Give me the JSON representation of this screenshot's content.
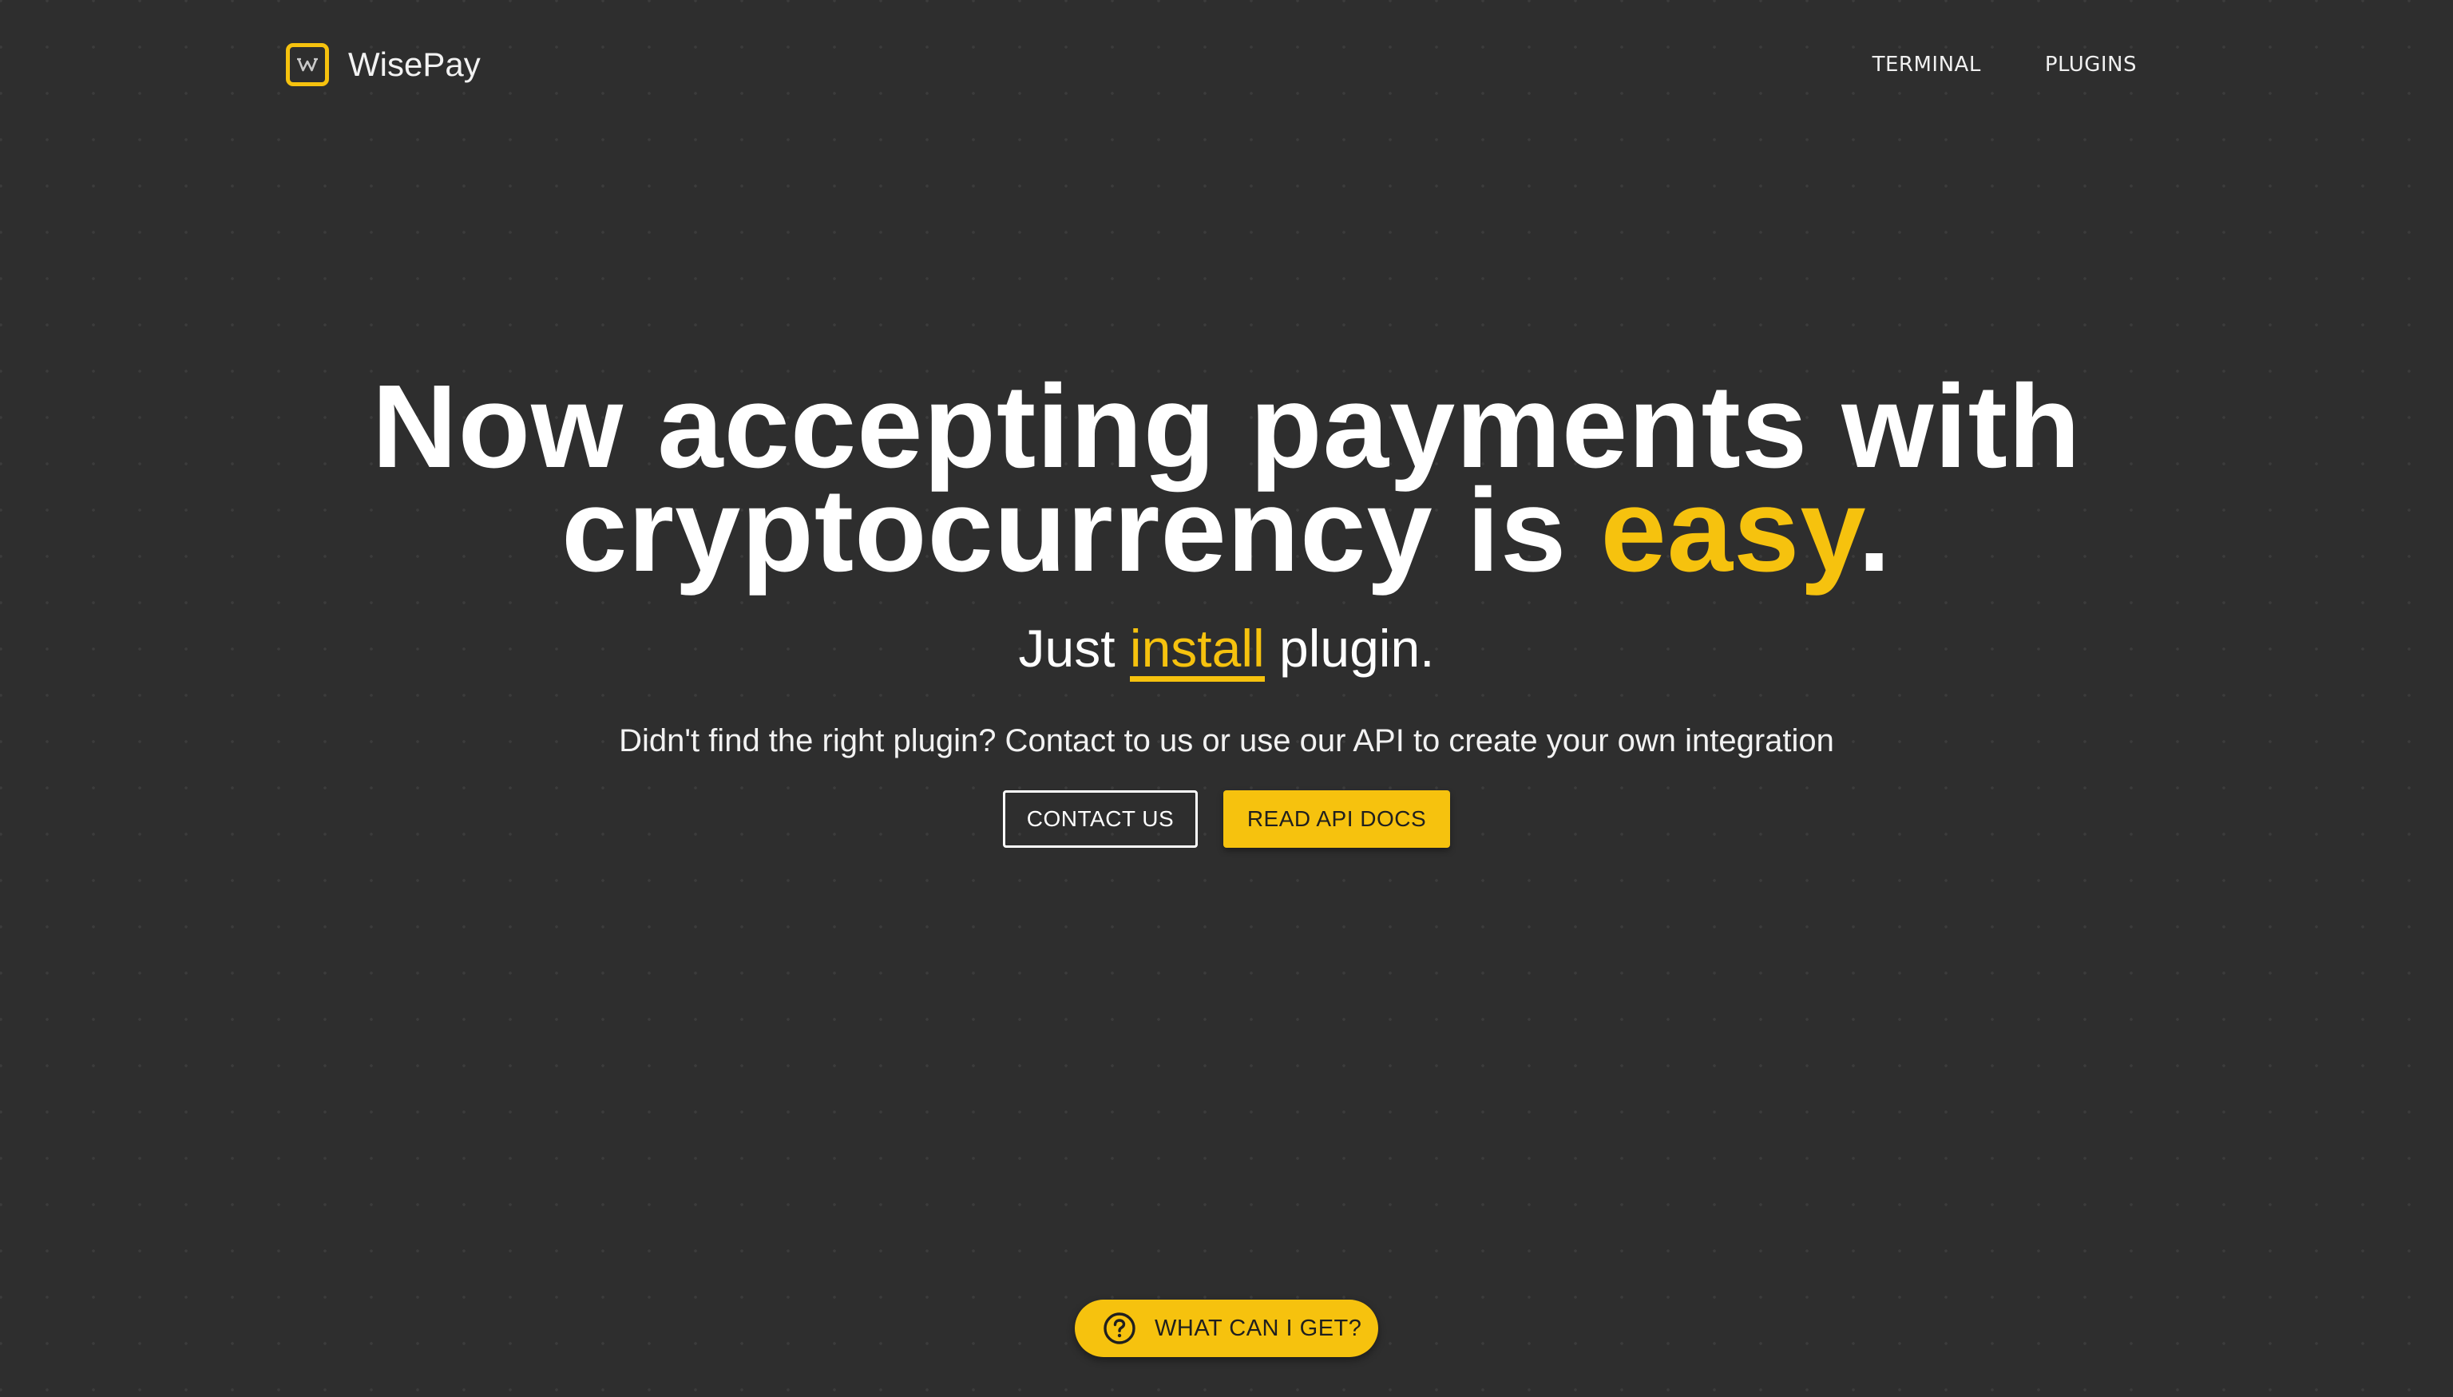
{
  "brand": {
    "name": "WisePay",
    "logo_letter": "W",
    "logo_icon": "wisepay-logo-icon"
  },
  "nav": {
    "items": [
      {
        "label": "TERMINAL"
      },
      {
        "label": "PLUGINS"
      }
    ]
  },
  "hero": {
    "title_line1": "Now accepting payments with",
    "title_line2_prefix": "cryptocurrency is ",
    "title_accent": "easy",
    "title_suffix": ".",
    "subtitle_prefix": "Just ",
    "subtitle_accent": "install",
    "subtitle_suffix": " plugin.",
    "description": "Didn't find the right plugin? Contact to us or use our API to create your own integration"
  },
  "actions": {
    "contact_label": "CONTACT US",
    "api_docs_label": "READ API DOCS"
  },
  "faq_pill": {
    "label": "WHAT CAN I GET?",
    "icon": "question-circle-icon"
  },
  "colors": {
    "background": "#2e2e2e",
    "accent": "#f6c20e",
    "text": "#ffffff",
    "dark_text": "#1f1f1f"
  }
}
